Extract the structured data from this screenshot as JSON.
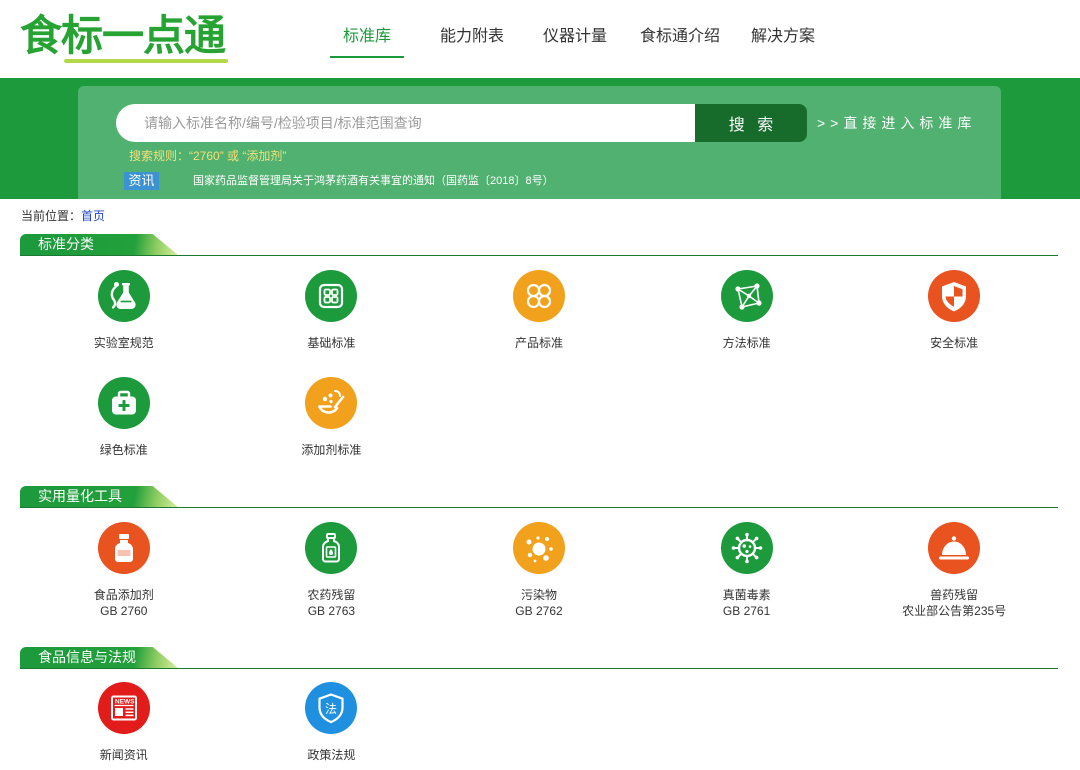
{
  "logo": {
    "text": "食标一点通"
  },
  "nav": {
    "items": [
      {
        "label": "标准库",
        "active": true
      },
      {
        "label": "能力附表",
        "active": false
      },
      {
        "label": "仪器计量",
        "active": false
      },
      {
        "label": "食标通介绍",
        "active": false
      },
      {
        "label": "解决方案",
        "active": false
      }
    ]
  },
  "search": {
    "placeholder": "请输入标准名称/编号/检验项目/标准范围查询",
    "button_label": "搜 索",
    "direct_link_label": ">>直接进入标准库",
    "rules_label": "搜索规则：",
    "rules_example": "“2760” 或 “添加剂”"
  },
  "news_ticker": {
    "badge": "资讯",
    "headline": "国家药品监督管理局关于鸿茅药酒有关事宜的通知（国药监〔2018〕8号）"
  },
  "breadcrumb": {
    "prefix": "当前位置：",
    "home": "首页"
  },
  "sections": [
    {
      "title": "标准分类",
      "items": [
        {
          "label": "实验室规范",
          "icon": "lab-flask-icon",
          "color": "#1c9a3c"
        },
        {
          "label": "基础标准",
          "icon": "grid-icon",
          "color": "#1c9a3c"
        },
        {
          "label": "产品标准",
          "icon": "clover-icon",
          "color": "#f2a11c"
        },
        {
          "label": "方法标准",
          "icon": "network-icon",
          "color": "#1c9a3c"
        },
        {
          "label": "安全标准",
          "icon": "shield-icon",
          "color": "#e8531f"
        },
        {
          "label": "绿色标准",
          "icon": "first-aid-kit-icon",
          "color": "#1c9a3c"
        },
        {
          "label": "添加剂标准",
          "icon": "spoon-icon",
          "color": "#f2a11c"
        }
      ]
    },
    {
      "title": "实用量化工具",
      "items": [
        {
          "label": "食品添加剂",
          "sublabel": "GB 2760",
          "icon": "bottle-icon",
          "color": "#e8531f"
        },
        {
          "label": "农药残留",
          "sublabel": "GB 2763",
          "icon": "pesticide-bottle-icon",
          "color": "#1c9a3c"
        },
        {
          "label": "污染物",
          "sublabel": "GB 2762",
          "icon": "particles-icon",
          "color": "#f2a11c"
        },
        {
          "label": "真菌毒素",
          "sublabel": "GB 2761",
          "icon": "virus-icon",
          "color": "#1c9a3c"
        },
        {
          "label": "兽药残留",
          "sublabel": "农业部公告第235号",
          "icon": "cloche-icon",
          "color": "#e8531f"
        }
      ]
    },
    {
      "title": "食品信息与法规",
      "items": [
        {
          "label": "新闻资讯",
          "icon": "news-icon",
          "icon_text": "NEWS",
          "color": "#e21b1b"
        },
        {
          "label": "政策法规",
          "icon": "law-shield-icon",
          "icon_text": "法",
          "color": "#1f8fe0"
        }
      ]
    }
  ],
  "colors": {
    "brand_green": "#1c9a3c",
    "logo_green": "#26a332",
    "logo_accent": "#b3d94a",
    "search_button": "#176c2c",
    "rules_yellow": "#f3e07a",
    "badge_blue": "#3d92d4",
    "link_blue": "#2046c8",
    "section_line": "#1b7a31"
  }
}
